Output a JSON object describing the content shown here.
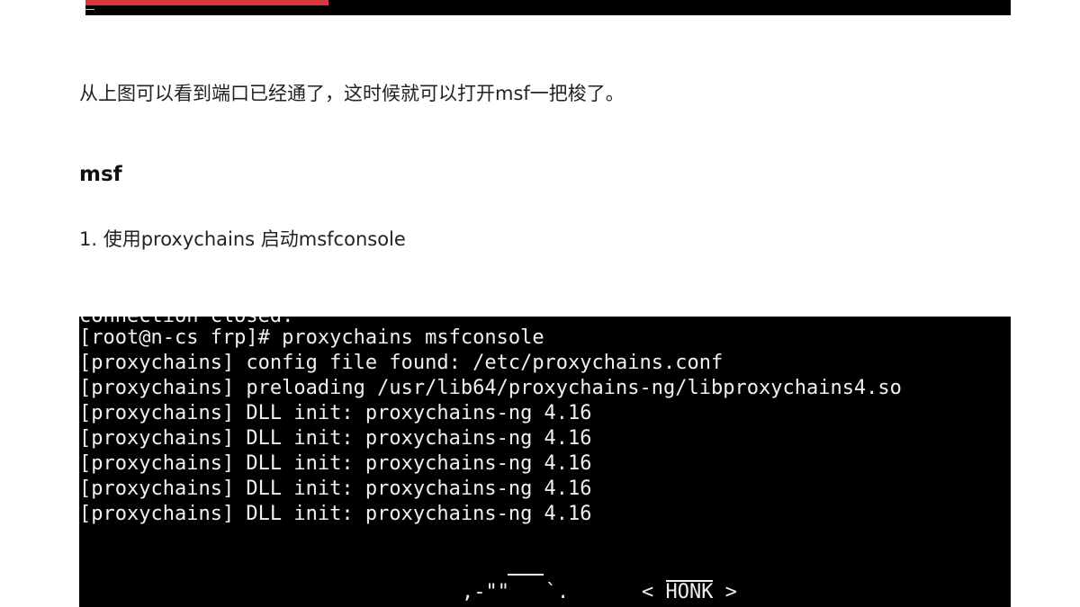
{
  "top_image": {
    "accent_color": "#d9383c"
  },
  "paragraph": "从上图可以看到端口已经通了，这时候就可以打开msf一把梭了。",
  "section_heading": "msf",
  "step_1": "1. 使用proxychains 启动msfconsole",
  "terminal": {
    "cut_line": "connection closed.",
    "lines": [
      "[root@n-cs frp]# proxychains msfconsole",
      "[proxychains] config file found: /etc/proxychains.conf",
      "[proxychains] preloading /usr/lib64/proxychains-ng/libproxychains4.so",
      "[proxychains] DLL init: proxychains-ng 4.16",
      "[proxychains] DLL init: proxychains-ng 4.16",
      "[proxychains] DLL init: proxychains-ng 4.16",
      "[proxychains] DLL init: proxychains-ng 4.16",
      "[proxychains] DLL init: proxychains-ng 4.16"
    ],
    "ascii_goose": ",-\"\"   `.",
    "honk_left": "< ",
    "honk_word": "HONK",
    "honk_right": " >"
  }
}
